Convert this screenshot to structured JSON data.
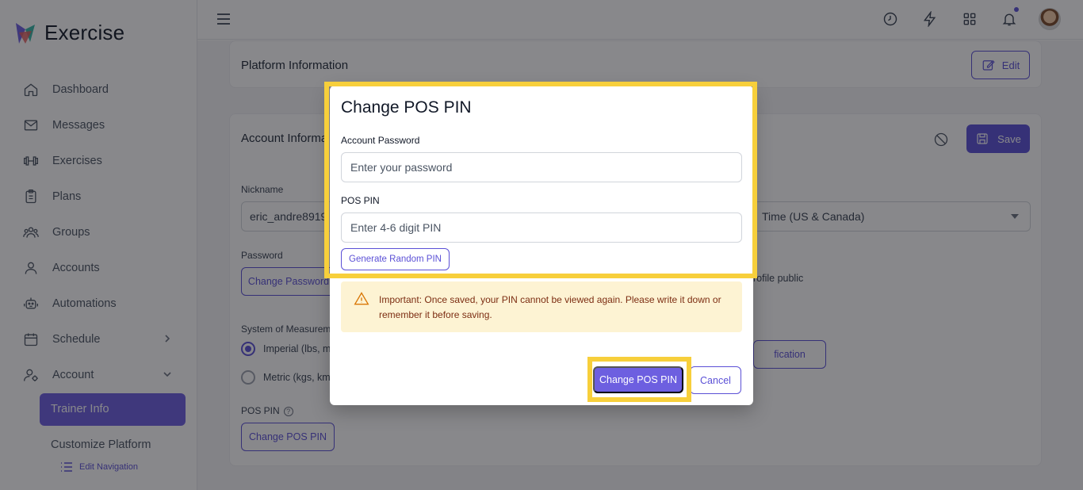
{
  "app": {
    "name": "Exercise"
  },
  "sidebar": {
    "items": [
      {
        "label": "Dashboard",
        "icon": "home-icon"
      },
      {
        "label": "Messages",
        "icon": "mail-icon"
      },
      {
        "label": "Exercises",
        "icon": "dumbbell-icon"
      },
      {
        "label": "Plans",
        "icon": "clipboard-icon"
      },
      {
        "label": "Groups",
        "icon": "users-icon"
      },
      {
        "label": "Accounts",
        "icon": "user-icon"
      },
      {
        "label": "Automations",
        "icon": "robot-icon"
      },
      {
        "label": "Schedule",
        "icon": "calendar-icon",
        "chevron": "chevron-right"
      },
      {
        "label": "Account",
        "icon": "user-gear-icon",
        "chevron": "chevron-down"
      }
    ],
    "subitems": {
      "active": "Trainer Info",
      "customize": "Customize Platform",
      "edit_nav": "Edit Navigation"
    }
  },
  "topbar": {
    "icons": [
      "menu-icon",
      "clock-icon",
      "bolt-icon",
      "grid-icon",
      "bell-icon",
      "avatar"
    ]
  },
  "platform_card": {
    "title": "Platform Information",
    "edit_label": "Edit"
  },
  "account_card": {
    "title": "Account Informa",
    "save_label": "Save",
    "nickname_label": "Nickname",
    "nickname_value": "eric_andre8919",
    "timezone_value": "Time (US & Canada)",
    "password_label": "Password",
    "change_password_label": "Change Password",
    "profile_public_text": "rofile public",
    "measurement_label": "System of Measureme",
    "imperial_label": "Imperial (lbs, mi",
    "metric_label": "Metric (kgs, kms",
    "verify_label": "fication",
    "pos_pin_label": "POS PIN",
    "change_pos_pin_label": "Change POS PIN"
  },
  "modal": {
    "title": "Change POS PIN",
    "password_label": "Account Password",
    "password_placeholder": "Enter your password",
    "pin_label": "POS PIN",
    "pin_placeholder": "Enter 4-6 digit PIN",
    "generate_label": "Generate Random PIN",
    "warning_text": "Important: Once saved, your PIN cannot be viewed again. Please write it down or remember it before saving.",
    "submit_label": "Change POS PIN",
    "cancel_label": "Cancel"
  },
  "colors": {
    "accent": "#5b50d6",
    "accent_fill": "#6d5fe0",
    "highlight": "#f7cf3b",
    "warning_bg": "#fdf3d3"
  }
}
